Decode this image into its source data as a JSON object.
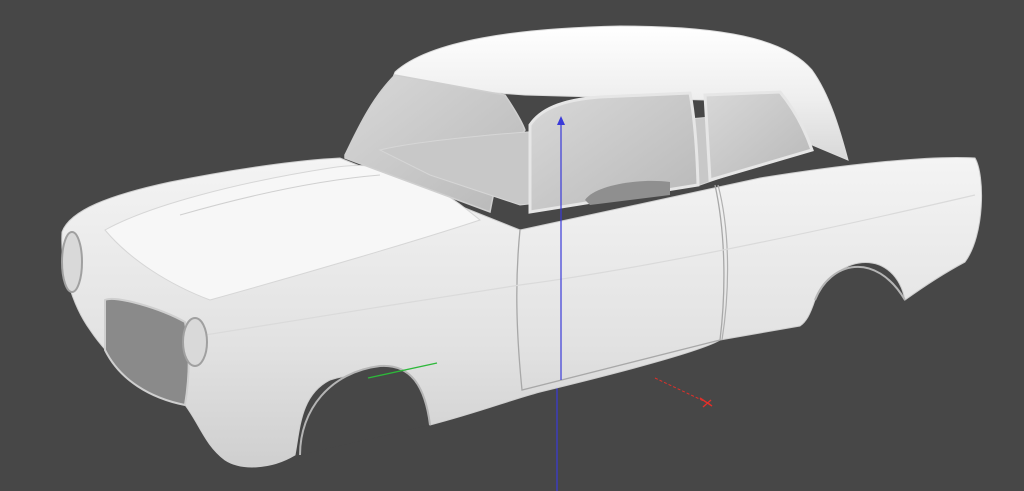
{
  "viewport": {
    "background_color": "#474747",
    "model": {
      "name": "car-body-shell",
      "body_color": "#f2f2f2",
      "shade_color": "#cfcfcf",
      "dark_color": "#9a9a9a",
      "interior_color": "#bdbdbd"
    },
    "axes": {
      "x_color": "#e0302a",
      "y_color": "#2db83a",
      "z_color": "#3a3ad8",
      "origin_marker_color": "#d23a3a"
    }
  }
}
